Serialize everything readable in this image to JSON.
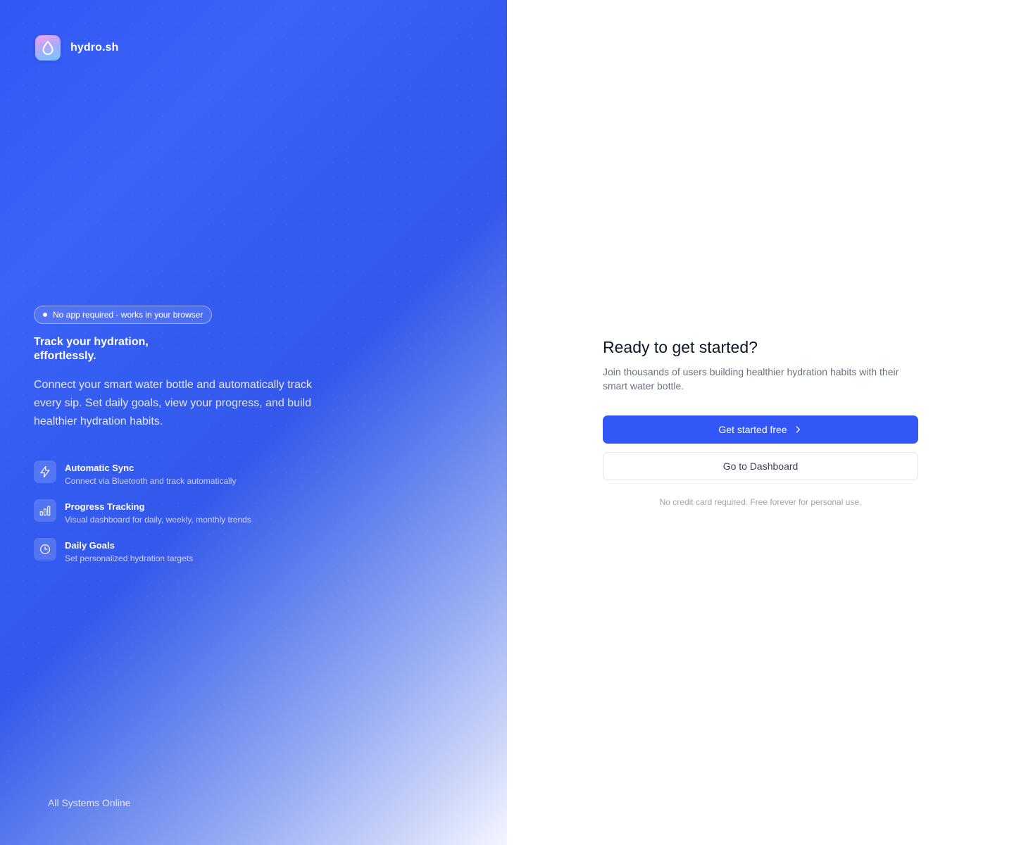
{
  "brand": {
    "name": "hydro.sh",
    "logo_icon": "droplet-icon",
    "logo_gradient": [
      "#f4a6f0",
      "#b7a6fb",
      "#6dc9fb"
    ]
  },
  "hero": {
    "badge": "No app required - works in your browser",
    "headline": "Track your hydration, effortlessly.",
    "description": "Connect your smart water bottle and automatically track every sip. Set daily goals, view your progress, and build healthier hydration habits."
  },
  "features": [
    {
      "icon": "lightning-icon",
      "title": "Automatic Sync",
      "description": "Connect via Bluetooth and track automatically"
    },
    {
      "icon": "bar-chart-icon",
      "title": "Progress Tracking",
      "description": "Visual dashboard for daily, weekly, monthly trends"
    },
    {
      "icon": "clock-icon",
      "title": "Daily Goals",
      "description": "Set personalized hydration targets"
    }
  ],
  "status": {
    "text": "All Systems Online"
  },
  "cta": {
    "title": "Ready to get started?",
    "subtitle": "Join thousands of users building healthier hydration habits with their smart water bottle.",
    "primary_label": "Get started free",
    "primary_icon": "chevron-right-icon",
    "secondary_label": "Go to Dashboard",
    "note": "No credit card required. Free forever for personal use."
  },
  "colors": {
    "accent": "#3257f6",
    "panel_gradient_start": "#3158f5",
    "panel_gradient_end": "#f4f6ff"
  }
}
